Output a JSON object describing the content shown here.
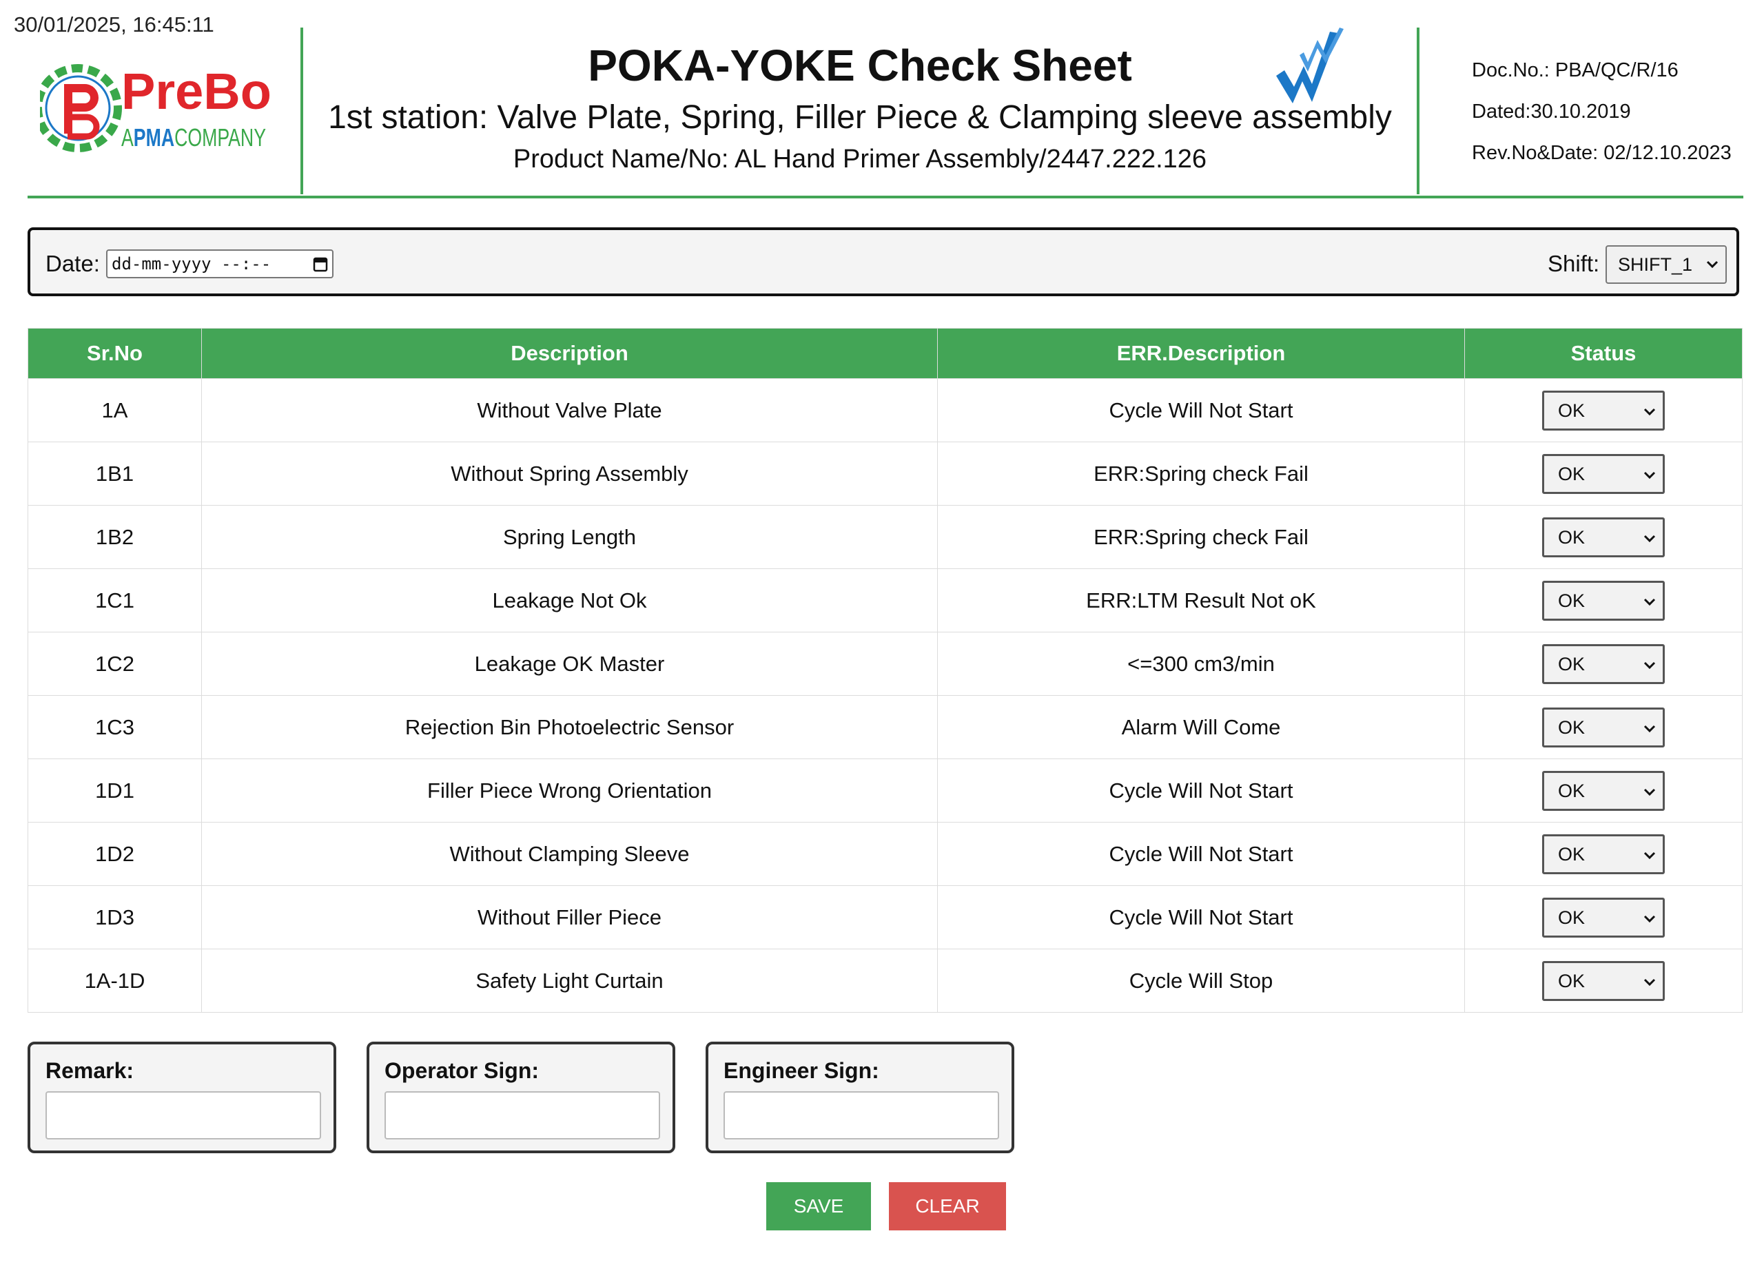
{
  "timestamp": "30/01/2025, 16:45:11",
  "logo": {
    "brand": "PreBo",
    "tagline_a": "A",
    "tagline_pma": "PMA",
    "tagline_company": "COMPANY"
  },
  "header": {
    "title": "POKA-YOKE Check Sheet",
    "station": "1st station: Valve Plate, Spring, Filler Piece & Clamping sleeve assembly",
    "product": "Product Name/No: AL Hand Primer Assembly/2447.222.126"
  },
  "doc": {
    "doc_no": "Doc.No.: PBA/QC/R/16",
    "dated": "Dated:30.10.2019",
    "rev": "Rev.No&Date: 02/12.10.2023"
  },
  "filters": {
    "date_label": "Date:",
    "date_placeholder": "dd-mm-yyyy --:--",
    "shift_label": "Shift:",
    "shift_value": "SHIFT_1"
  },
  "table": {
    "headers": [
      "Sr.No",
      "Description",
      "ERR.Description",
      "Status"
    ],
    "rows": [
      {
        "sr": "1A",
        "desc": "Without Valve Plate",
        "err": "Cycle Will Not Start",
        "status": "OK"
      },
      {
        "sr": "1B1",
        "desc": "Without Spring Assembly",
        "err": "ERR:Spring check Fail",
        "status": "OK"
      },
      {
        "sr": "1B2",
        "desc": "Spring Length",
        "err": "ERR:Spring check Fail",
        "status": "OK"
      },
      {
        "sr": "1C1",
        "desc": "Leakage Not Ok",
        "err": "ERR:LTM Result Not oK",
        "status": "OK"
      },
      {
        "sr": "1C2",
        "desc": "Leakage OK Master",
        "err": "<=300 cm3/min",
        "status": "OK"
      },
      {
        "sr": "1C3",
        "desc": "Rejection Bin Photoelectric Sensor",
        "err": "Alarm Will Come",
        "status": "OK"
      },
      {
        "sr": "1D1",
        "desc": "Filler Piece Wrong Orientation",
        "err": "Cycle Will Not Start",
        "status": "OK"
      },
      {
        "sr": "1D2",
        "desc": "Without Clamping Sleeve",
        "err": "Cycle Will Not Start",
        "status": "OK"
      },
      {
        "sr": "1D3",
        "desc": "Without Filler Piece",
        "err": "Cycle Will Not Start",
        "status": "OK"
      },
      {
        "sr": "1A-1D",
        "desc": "Safety Light Curtain",
        "err": "Cycle Will Stop",
        "status": "OK"
      }
    ]
  },
  "footer": {
    "remark_label": "Remark:",
    "operator_label": "Operator Sign:",
    "engineer_label": "Engineer Sign:",
    "save_label": "SAVE",
    "clear_label": "CLEAR"
  },
  "colors": {
    "accent_green": "#43a556",
    "danger_red": "#d9534f",
    "logo_red": "#e0262b",
    "logo_green": "#3aa84a",
    "logo_blue": "#1c78c7"
  }
}
